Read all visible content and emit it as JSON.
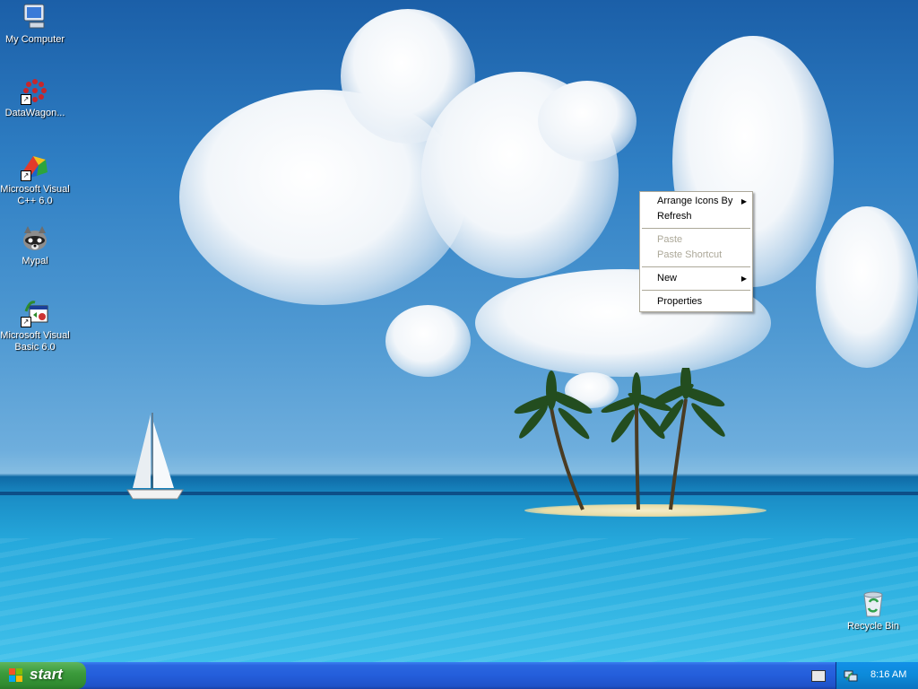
{
  "desktop": {
    "icons": [
      {
        "label": "My Computer",
        "icon": "my-computer-icon"
      },
      {
        "label": "DataWagon...",
        "icon": "datawagon-icon"
      },
      {
        "label": "Microsoft Visual C++ 6.0",
        "icon": "visual-cpp-icon"
      },
      {
        "label": "Mypal",
        "icon": "mypal-icon"
      },
      {
        "label": "Microsoft Visual Basic 6.0",
        "icon": "visual-basic-icon"
      },
      {
        "label": "Recycle Bin",
        "icon": "recycle-bin-icon"
      }
    ]
  },
  "context_menu": {
    "items": [
      {
        "label": "Arrange Icons By",
        "submenu": true,
        "enabled": true
      },
      {
        "label": "Refresh",
        "enabled": true
      },
      {
        "label": "Paste",
        "enabled": false
      },
      {
        "label": "Paste Shortcut",
        "enabled": false
      },
      {
        "label": "New",
        "submenu": true,
        "enabled": true
      },
      {
        "label": "Properties",
        "enabled": true
      }
    ]
  },
  "taskbar": {
    "start_label": "start",
    "clock": "8:16 AM"
  },
  "colors": {
    "taskbar_blue": "#245edb",
    "start_green": "#3c9b3c",
    "tray_blue": "#0c8ad9",
    "menu_disabled": "#aca899"
  }
}
